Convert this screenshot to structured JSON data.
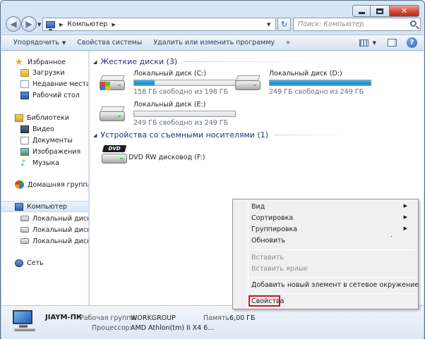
{
  "address": {
    "path_item": "Компьютер"
  },
  "search": {
    "placeholder": "Поиск: Компьютер"
  },
  "toolbar": {
    "organize": "Упорядочить",
    "system_properties": "Свойства системы",
    "uninstall": "Удалить или изменить программу",
    "more": "»"
  },
  "navpane": {
    "favorites": "Избранное",
    "downloads": "Загрузки",
    "recent": "Недавние места",
    "desktop": "Рабочий стол",
    "libraries": "Библиотеки",
    "video": "Видео",
    "documents": "Документы",
    "images": "Изображения",
    "music": "Музыка",
    "homegroup": "Домашняя группа",
    "computer": "Компьютер",
    "drive_c": "Локальный диск (C",
    "drive_d": "Локальный диск (D",
    "drive_e": "Локальный диск (E:",
    "network": "Сеть"
  },
  "content": {
    "hdd_header": "Жесткие диски (3)",
    "removable_header": "Устройства со съемными носителями (1)",
    "drives": [
      {
        "name": "Локальный диск (C:)",
        "free": "158 ГБ свободно из 198 ГБ",
        "used_fraction": 0.2
      },
      {
        "name": "Локальный диск (D:)",
        "free": "249 ГБ свободно из 249 ГБ",
        "used_fraction": 1.0
      },
      {
        "name": "Локальный диск (E:)",
        "free": "249 ГБ свободно из 249 ГБ",
        "used_fraction": 0.0
      }
    ],
    "dvd": {
      "name": "DVD RW дисковод (F:)",
      "label": "DVD"
    }
  },
  "details": {
    "name": "JIAYM-ПК",
    "workgroup_label": "Рабочая группа:",
    "workgroup_value": "WORKGROUP",
    "memory_label": "Память:",
    "memory_value": "6,00 ГБ",
    "cpu_label": "Процессор:",
    "cpu_value": "AMD Athlon(tm) II X4 6..."
  },
  "context_menu": {
    "view": "Вид",
    "sort": "Сортировка",
    "group": "Группировка",
    "refresh": "Обновить",
    "paste": "Вставить",
    "paste_shortcut": "Вставить ярлык",
    "add_network": "Добавить новый элемент в сетевое окружение",
    "properties": "Свойства"
  },
  "colors": {
    "accent_header": "#1e3287",
    "highlight_box": "#d6101b",
    "progress_fill": "#2aa2d6"
  }
}
